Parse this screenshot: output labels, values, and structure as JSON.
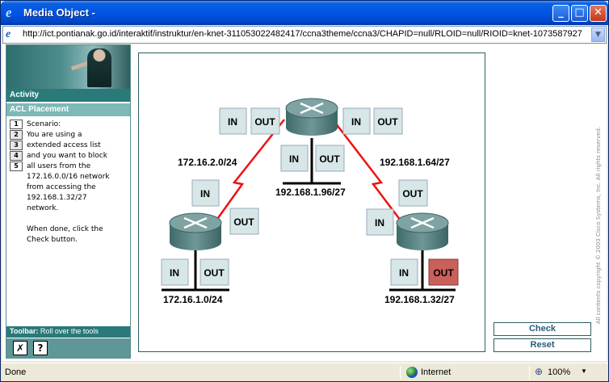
{
  "window": {
    "title": "Media Object -",
    "minimize": "_",
    "maximize": "□",
    "close": "✕"
  },
  "address": {
    "url": "http://ict.pontianak.go.id/interaktif/instruktur/en-knet-311053022482417/ccna3theme/ccna3/CHAPID=null/RLOID=null/RIOID=knet-1073587927"
  },
  "sidebar": {
    "activity": "Activity",
    "section": "ACL Placement",
    "steps": [
      "1",
      "2",
      "3",
      "4",
      "5"
    ],
    "scenario": "Scenario:\nYou are using a\nextended  access list\nand you want to block\nall users from the\n172.16.0.0/16 network\nfrom accessing the\n192.168.1.32/27\nnetwork.\n\nWhen done, click the\nCheck button.",
    "toolbar_label": "Toolbar:",
    "toolbar_hint": "Roll over the tools",
    "tools": [
      "✗",
      "?"
    ]
  },
  "diagram": {
    "in": "IN",
    "out": "OUT",
    "networks": {
      "left_link": "172.16.2.0/24",
      "right_link": "192.168.1.64/27",
      "center_lan": "192.168.1.96/27",
      "left_lan": "172.16.1.0/24",
      "right_lan": "192.168.1.32/27"
    },
    "colors": {
      "link": "#ee1111",
      "box": "#d7e7e7",
      "box_selected": "#c9605a",
      "router_top": "#7fa3a3",
      "router_body": "#5c8585"
    }
  },
  "buttons": {
    "check": "Check",
    "reset": "Reset"
  },
  "copyright": "All contents copyright © 2003 Cisco Systems, Inc. All rights reserved.",
  "status": {
    "left": "Done",
    "zone": "Internet",
    "zoom": "100%"
  }
}
